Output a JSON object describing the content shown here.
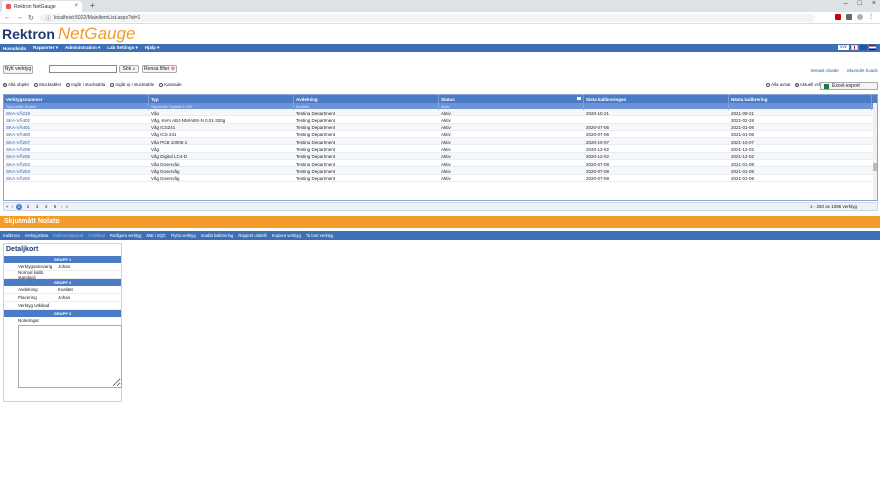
{
  "browser": {
    "tab_title": "Rektron NetGauge",
    "url": "localhost:5022/MainItemList.aspx?id=1"
  },
  "logo": {
    "part1": "Rektron",
    "part2": "NetGauge"
  },
  "menu": {
    "items": [
      "Huvudsida",
      "Rapporter ▾",
      "Administration ▾",
      "Lab Settings ▾",
      "Hjälp ▾"
    ],
    "language": "SVE"
  },
  "toolbar": {
    "new_tool": "Nytt verktyg",
    "search_value": "",
    "search_button": "Sök",
    "clear_filter": "Rensa filter",
    "recent": "Senast visade",
    "latest": "Skumdet hoadc"
  },
  "radios": {
    "left": [
      "Alla objekt",
      "Stucktabler",
      "Ingår i stucktabla",
      "Ingår ej i stucktable",
      "Kassade"
    ],
    "right": [
      "Alla avsar",
      "Aktuell vckt"
    ]
  },
  "excel_label": "Excel-export",
  "grid": {
    "headers": [
      "Verktygsnummer",
      "Typ",
      "Avdelning",
      "Status",
      "Sista kalibreringen",
      "Nästa kalibrering"
    ],
    "filters": [
      "Skjuvmått Nolato",
      "Skjutmått Digitalt 0-150",
      "Kvalitet",
      "Aktiv",
      "",
      ""
    ],
    "rows": [
      [
        "SKA-VÅ219",
        "Våg",
        "Testing Department",
        "Aktiv",
        "2020-10-21",
        "2021-09-21"
      ],
      [
        "SKA-VÅ402",
        "Våg, Kern ABJ-NM/ABS-N 0,01-320g",
        "Testing Department",
        "Aktiv",
        "",
        "2021-02-28"
      ],
      [
        "SKA-VÅ401",
        "Våg ICS241",
        "Testing Department",
        "Aktiv",
        "2020-07-06",
        "2021-01-06"
      ],
      [
        "SKA-VÅ400",
        "Våg ICS 241",
        "Testing Department",
        "Aktiv",
        "2020-07-06",
        "2021-01-06"
      ],
      [
        "SKA-VÅ207",
        "Våg PCB 10005-1",
        "Testing Department",
        "Aktiv",
        "2020-10-07",
        "2021-10-07"
      ],
      [
        "SKA-VÅ206",
        "Våg",
        "Testing Department",
        "Aktiv",
        "2020-12-02",
        "2021-12-02"
      ],
      [
        "SKA-VÅ205",
        "Våg Digital LC4-D",
        "Testing Department",
        "Aktiv",
        "2020-12-02",
        "2021-12-02"
      ],
      [
        "SKA-VÅ204",
        "Våg Doservåg",
        "Testing Department",
        "Aktiv",
        "2020-07-08",
        "2021-01-08"
      ],
      [
        "SKA-VÅ203",
        "Våg Doservåg",
        "Testing Department",
        "Aktiv",
        "2020-07-08",
        "2021-01-08"
      ],
      [
        "SKA-VÅ202",
        "Våg Doservåg",
        "Testing Department",
        "Aktiv",
        "2020-07-08",
        "2021-01-08"
      ]
    ]
  },
  "pager": {
    "pages": [
      "1",
      "2",
      "3",
      "4",
      "5"
    ],
    "info": "1 - 250 av 1095 verktyg"
  },
  "selected_title": "Skjutmått Nolato",
  "actions": [
    {
      "label": "Kalibrera",
      "dim": false
    },
    {
      "label": "Verktygslista",
      "dim": false
    },
    {
      "label": "Kalibreringsserti",
      "dim": true
    },
    {
      "label": "Certifikat",
      "dim": true
    },
    {
      "label": "Redigera verktyg",
      "dim": false
    },
    {
      "label": "Mät i SQC",
      "dim": false
    },
    {
      "label": "Flytta verktyg",
      "dim": false
    },
    {
      "label": "Snabb kalibrering",
      "dim": false
    },
    {
      "label": "Rapport utskrift",
      "dim": false
    },
    {
      "label": "Kopiera verktyg",
      "dim": false
    },
    {
      "label": "Ta bort verktyg",
      "dim": false
    }
  ],
  "detail": {
    "title": "Detaljkort",
    "group1": "GRUPP 1",
    "group2": "GRUPP 2",
    "group3": "GRUPP 3",
    "rows1": [
      {
        "label": "Verktygsansvarig",
        "value": "Johan"
      },
      {
        "label": "Normal kalib. standard",
        "value": ""
      }
    ],
    "rows2": [
      {
        "label": "Avdelning",
        "value": "Kvalitet"
      },
      {
        "label": "Placering",
        "value": "Johan"
      },
      {
        "label": "Verktyg Utkikad",
        "value": ""
      }
    ],
    "notes_label": "Noteringar"
  }
}
